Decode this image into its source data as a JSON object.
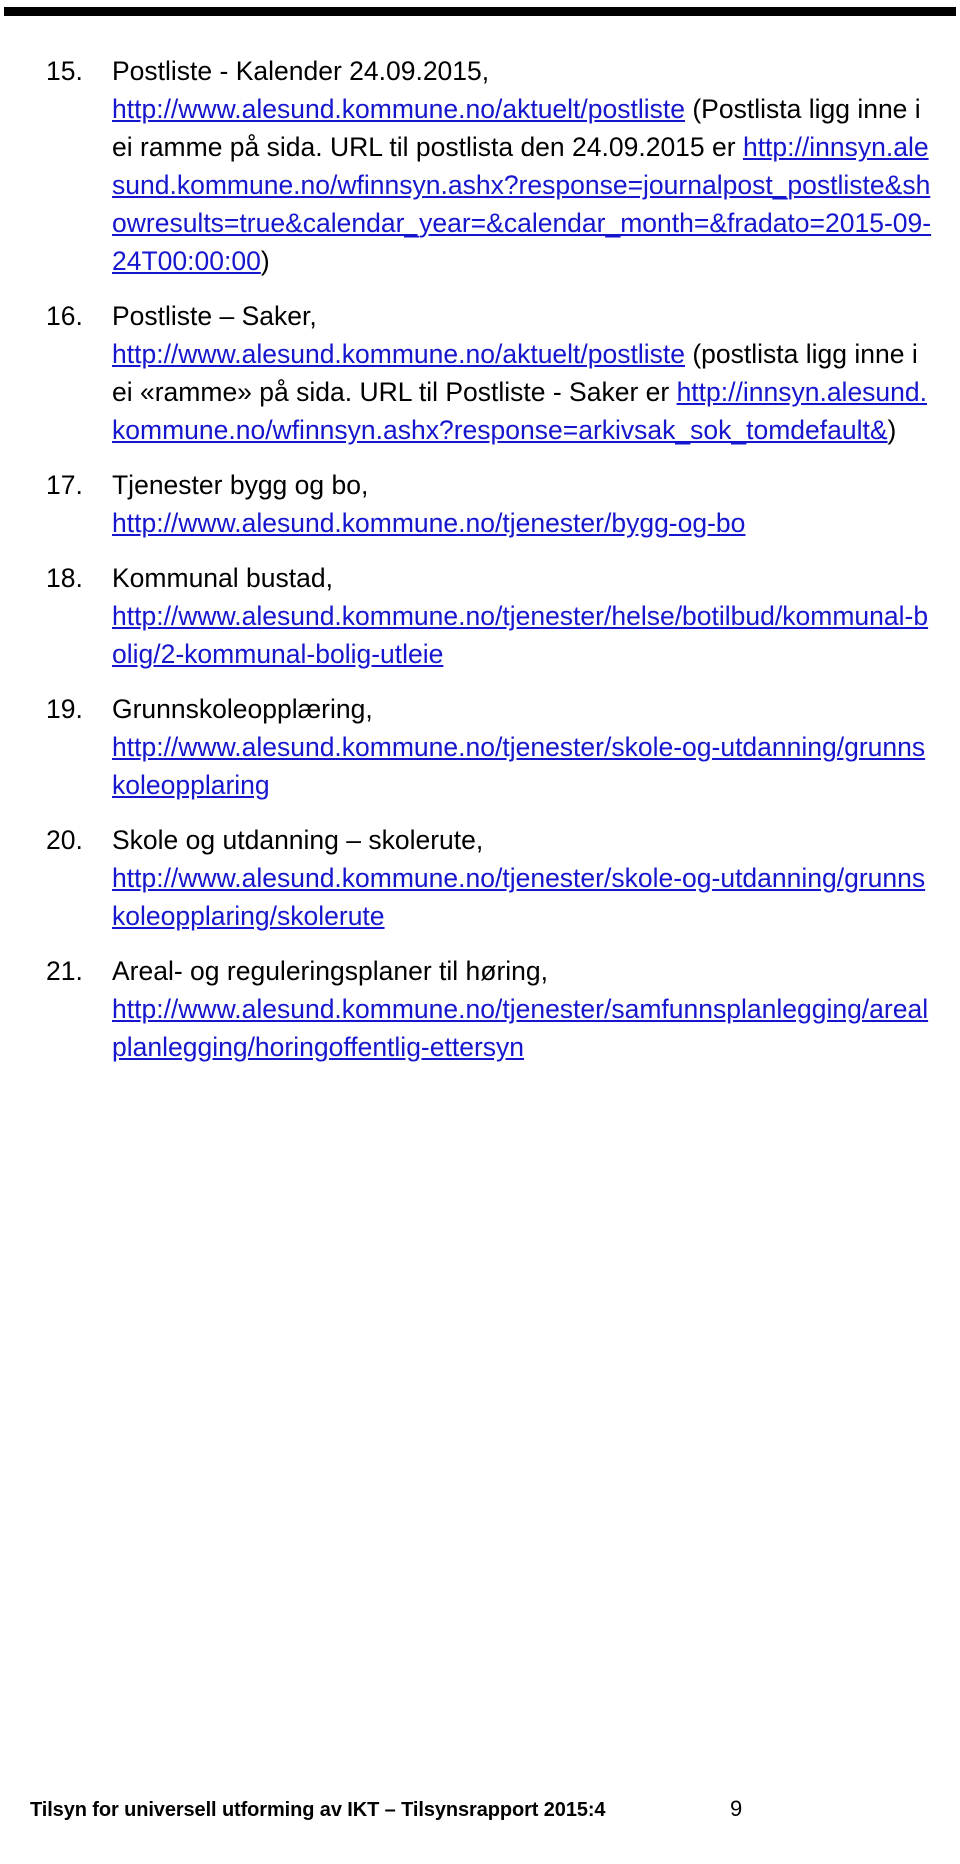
{
  "document": {
    "page_number": "9",
    "footer_text": "Tilsyn for universell utforming av IKT – Tilsynsrapport 2015:4",
    "link_color": "#1616CE",
    "text_color": "#000000"
  },
  "list": {
    "items": [
      {
        "number": "15.",
        "title": "Postliste - Kalender 24.09.2015,",
        "segments": [
          {
            "kind": "link",
            "text": "http://www.alesund.kommune.no/aktuelt/postliste"
          },
          {
            "kind": "plain",
            "text": " (Postlista ligg inne i ei ramme på sida. URL til postlista den 24.09.2015 er "
          },
          {
            "kind": "link",
            "text": "http://innsyn.alesund.kommune.no/wfinnsyn.ashx?response=journalpost_postliste&showresults=true&calendar_year=&calendar_month=&fradato=2015-09-24T00:00:00"
          },
          {
            "kind": "plain",
            "text": ")"
          }
        ]
      },
      {
        "number": "16.",
        "title": "Postliste – Saker,",
        "segments": [
          {
            "kind": "link",
            "text": "http://www.alesund.kommune.no/aktuelt/postliste"
          },
          {
            "kind": "plain",
            "text": " (postlista ligg inne i ei «ramme» på sida. URL til Postliste - Saker er "
          },
          {
            "kind": "link",
            "text": "http://innsyn.alesund.kommune.no/wfinnsyn.ashx?response=arkivsak_sok_tomdefault&"
          },
          {
            "kind": "plain",
            "text": ")"
          }
        ]
      },
      {
        "number": "17.",
        "title": "Tjenester bygg og bo,",
        "segments": [
          {
            "kind": "link",
            "text": "http://www.alesund.kommune.no/tjenester/bygg-og-bo"
          }
        ]
      },
      {
        "number": "18.",
        "title": "Kommunal bustad,",
        "segments": [
          {
            "kind": "link",
            "text": "http://www.alesund.kommune.no/tjenester/helse/botilbud/kommunal-bolig/2-kommunal-bolig-utleie"
          }
        ]
      },
      {
        "number": "19.",
        "title": "Grunnskoleopplæring,",
        "segments": [
          {
            "kind": "link",
            "text": "http://www.alesund.kommune.no/tjenester/skole-og-utdanning/grunnskoleopplaring"
          }
        ]
      },
      {
        "number": "20.",
        "title": "Skole og utdanning – skolerute,",
        "segments": [
          {
            "kind": "link",
            "text": "http://www.alesund.kommune.no/tjenester/skole-og-utdanning/grunnskoleopplaring/skolerute"
          }
        ]
      },
      {
        "number": "21.",
        "title": "Areal- og reguleringsplaner til høring,",
        "segments": [
          {
            "kind": "link",
            "text": "http://www.alesund.kommune.no/tjenester/samfunnsplanlegging/arealplanlegging/horingoffentlig-ettersyn"
          }
        ]
      }
    ]
  }
}
